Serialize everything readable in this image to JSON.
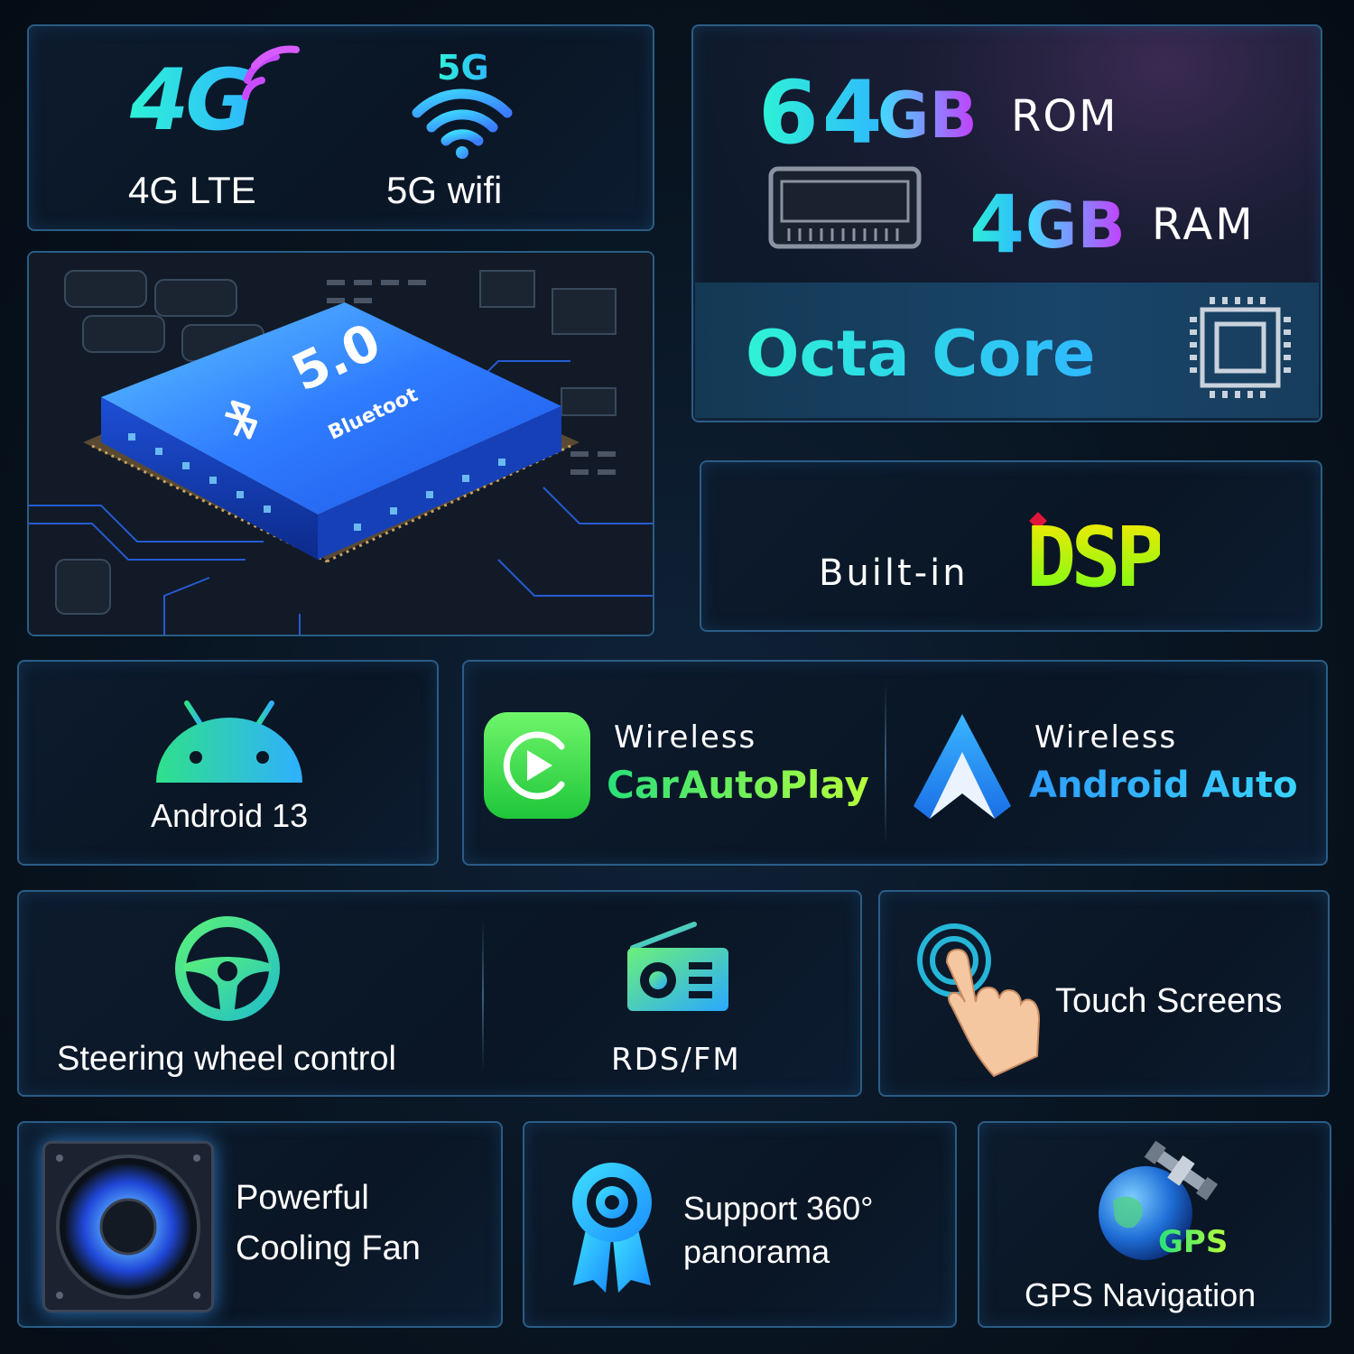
{
  "connectivity": {
    "net_badge": "4G",
    "lte_label": "4G LTE",
    "wifi_badge": "5G",
    "wifi_label": "5G wifi"
  },
  "bluetooth": {
    "version": "5.0",
    "brand": "Bluetoot"
  },
  "memory": {
    "rom_number": "64",
    "rom_unit": "GB",
    "rom_label": "ROM",
    "ram_number": "4",
    "ram_unit": "GB",
    "ram_label": "RAM",
    "cpu_label": "Octa Core"
  },
  "dsp": {
    "prefix": "Built-in",
    "logo": "DSP"
  },
  "android": {
    "label": "Android 13"
  },
  "carplay": {
    "top": "Wireless",
    "name": "CarAutoPlay"
  },
  "android_auto": {
    "top": "Wireless",
    "name": "Android Auto"
  },
  "steering": {
    "label": "Steering wheel control"
  },
  "radio": {
    "label": "RDS/FM"
  },
  "touch": {
    "label": "Touch Screens"
  },
  "fan": {
    "line1": "Powerful",
    "line2": "Cooling Fan"
  },
  "panorama": {
    "line1": "Support 360°",
    "line2": "panorama"
  },
  "gps": {
    "badge": "GPS",
    "label": "GPS Navigation"
  },
  "colors": {
    "accent_cyan": "#2ef2d6",
    "accent_green": "#3be870",
    "accent_blue": "#2fa4ff",
    "panel_border": "#2a5d86"
  }
}
